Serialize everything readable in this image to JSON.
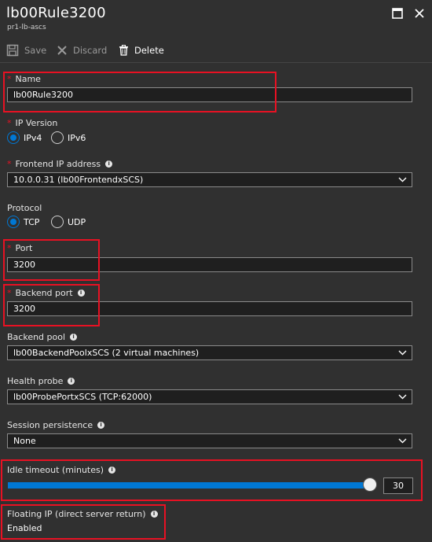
{
  "header": {
    "title": "lb00Rule3200",
    "subtitle": "pr1-lb-ascs"
  },
  "toolbar": {
    "save_label": "Save",
    "discard_label": "Discard",
    "delete_label": "Delete"
  },
  "form": {
    "name": {
      "label": "Name",
      "value": "lb00Rule3200"
    },
    "ip_version": {
      "label": "IP Version",
      "options": [
        "IPv4",
        "IPv6"
      ],
      "selected": "IPv4"
    },
    "frontend_ip": {
      "label": "Frontend IP address",
      "value": "10.0.0.31 (lb00FrontendxSCS)"
    },
    "protocol": {
      "label": "Protocol",
      "options": [
        "TCP",
        "UDP"
      ],
      "selected": "TCP"
    },
    "port": {
      "label": "Port",
      "value": "3200"
    },
    "backend_port": {
      "label": "Backend port",
      "value": "3200"
    },
    "backend_pool": {
      "label": "Backend pool",
      "value": "lb00BackendPoolxSCS (2 virtual machines)"
    },
    "health_probe": {
      "label": "Health probe",
      "value": "lb00ProbePortxSCS (TCP:62000)"
    },
    "session_persistence": {
      "label": "Session persistence",
      "value": "None"
    },
    "idle_timeout": {
      "label": "Idle timeout (minutes)",
      "value": "30",
      "min": 4,
      "max": 30
    },
    "floating_ip": {
      "label": "Floating IP (direct server return)",
      "value": "Enabled"
    }
  },
  "colors": {
    "background": "#303030",
    "accent": "#0078d4",
    "required": "#e81123",
    "highlight_box": "#e81123"
  }
}
